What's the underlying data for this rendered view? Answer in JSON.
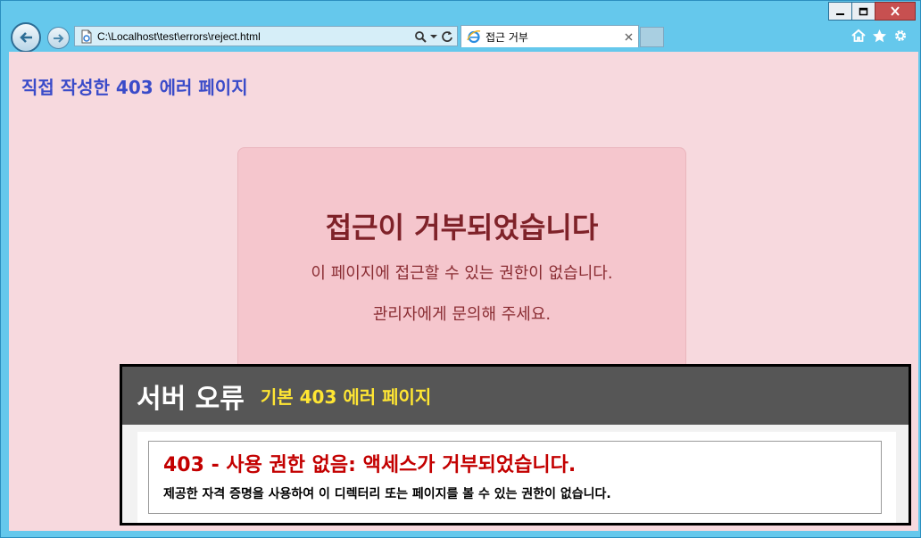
{
  "browser": {
    "address": "C:\\Localhost\\test\\errors\\reject.html",
    "tab_title": "접근 거부"
  },
  "page": {
    "heading": "직접 작성한 403 에러 페이지",
    "card": {
      "title": "접근이 거부되었습니다",
      "line1": "이 페이지에 접근할 수 있는 권한이 없습니다.",
      "line2": "관리자에게 문의해 주세요."
    }
  },
  "server_error": {
    "title": "서버 오류",
    "caption": "기본 403 에러 페이지",
    "error_title": "403 - 사용 권한 없음: 액세스가 거부되었습니다.",
    "error_desc": "제공한 자격 증명을 사용하여 이 디렉터리 또는 페이지를 볼 수 있는 권한이 없습니다."
  },
  "icons": {
    "back": "back-arrow-icon",
    "forward": "forward-arrow-icon",
    "page": "page-icon",
    "search": "search-icon",
    "refresh": "refresh-icon",
    "tab": "ie-icon",
    "close_tab": "close-icon",
    "home": "home-icon",
    "favorites": "star-icon",
    "settings": "gear-icon"
  },
  "colors": {
    "page_background": "#f7d9de",
    "heading": "#3a4bc9",
    "card_background": "#f5c6cd",
    "card_text": "#7f2229",
    "server_header": "#565656",
    "server_caption": "#ffe633",
    "error_title": "#c30000"
  }
}
